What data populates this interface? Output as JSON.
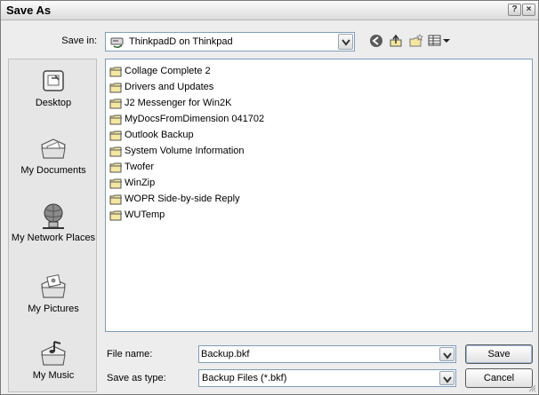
{
  "window": {
    "title": "Save As",
    "help_label": "?",
    "close_label": "×"
  },
  "savein": {
    "label": "Save in:",
    "value": "ThinkpadD on Thinkpad",
    "drive_icon": "network-drive-icon"
  },
  "toolbar": {
    "icons": [
      "back-icon",
      "up-folder-icon",
      "new-folder-icon",
      "views-menu-icon"
    ]
  },
  "places": [
    {
      "label": "Desktop",
      "icon": "desktop-icon"
    },
    {
      "label": "My Documents",
      "icon": "my-documents-icon"
    },
    {
      "label": "My Network Places",
      "icon": "network-places-icon"
    },
    {
      "label": "My Pictures",
      "icon": "my-pictures-icon"
    },
    {
      "label": "My Music",
      "icon": "my-music-icon"
    }
  ],
  "files": [
    "Collage Complete 2",
    "Drivers and Updates",
    "J2 Messenger for Win2K",
    "MyDocsFromDimension 041702",
    "Outlook Backup",
    "System Volume Information",
    "Twofer",
    "WinZip",
    "WOPR Side-by-side Reply",
    "WUTemp"
  ],
  "filename": {
    "label": "File name:",
    "value": "Backup.bkf"
  },
  "filetype": {
    "label": "Save as type:",
    "value": "Backup Files (*.bkf)"
  },
  "buttons": {
    "save": "Save",
    "cancel": "Cancel"
  },
  "colors": {
    "folder_fill": "#f4e7a1",
    "folder_stroke": "#555555",
    "window_bg": "#ededed"
  }
}
